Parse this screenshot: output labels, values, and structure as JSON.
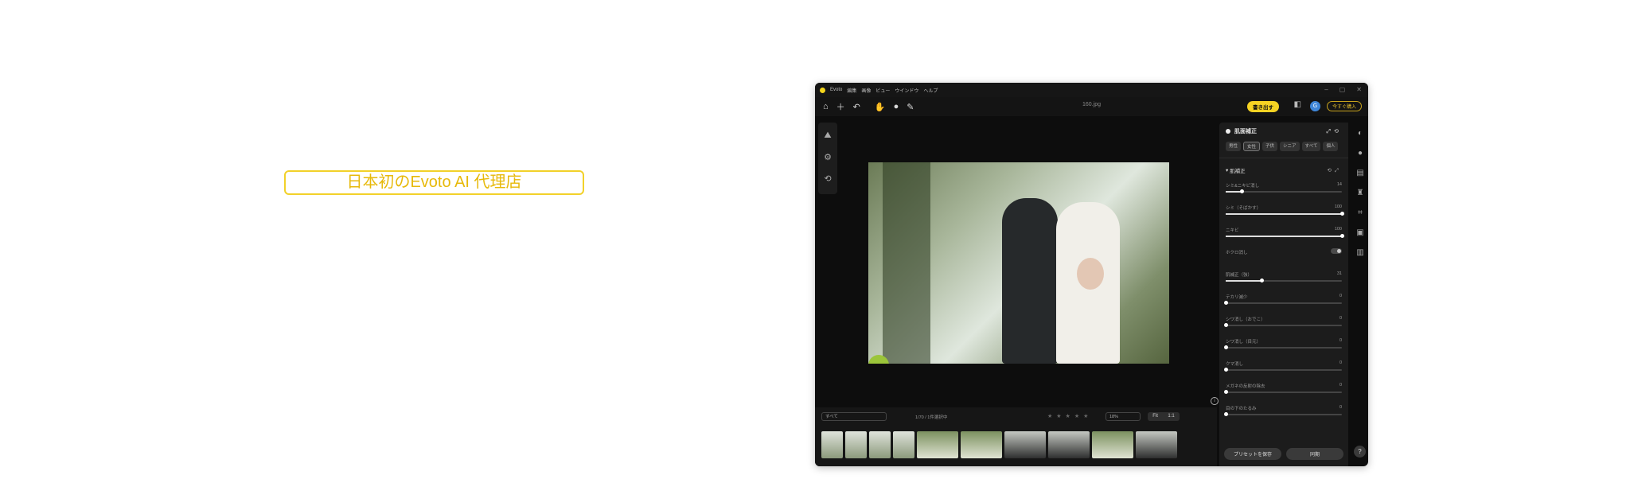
{
  "badge": "日本初のEvoto AI 代理店",
  "app": {
    "title": "Evoto",
    "menu": [
      "編集",
      "画像",
      "ビュー",
      "ウインドウ",
      "ヘルプ"
    ],
    "filename": "160.jpg",
    "export_label": "書き出す",
    "buy_label": "今すぐ購入",
    "avatar_initial": "G",
    "panel": {
      "title": "肌面補正",
      "chips": [
        "男性",
        "女性",
        "子供",
        "シニア",
        "すべて",
        "個人"
      ],
      "section": "肌補正",
      "sliders": [
        {
          "label": "シミ&ニキビ消し",
          "value": "14",
          "pct": 14
        },
        {
          "label": "シミ（そばかす）",
          "value": "100",
          "pct": 100
        },
        {
          "label": "ニキビ",
          "value": "100",
          "pct": 100
        }
      ],
      "toggle_label": "ホクロ消し",
      "sliders2": [
        {
          "label": "肌補正（強）",
          "value": "31",
          "pct": 31
        },
        {
          "label": "テカリ減少",
          "value": "0",
          "pct": 0
        },
        {
          "label": "シワ消し（おでこ）",
          "value": "0",
          "pct": 0
        },
        {
          "label": "シワ消し（目元）",
          "value": "0",
          "pct": 0
        },
        {
          "label": "クマ消し",
          "value": "0",
          "pct": 0
        },
        {
          "label": "メガネの反射の除去",
          "value": "0",
          "pct": 0
        },
        {
          "label": "目の下のたるみ",
          "value": "0",
          "pct": 0
        }
      ],
      "save_preset": "プリセットを保存",
      "sync": "同期"
    },
    "film": {
      "filter": "すべて",
      "count": "1/70 / 1件選択中",
      "zoom": "18%",
      "fit": "Fit",
      "one_to_one": "1:1"
    }
  }
}
